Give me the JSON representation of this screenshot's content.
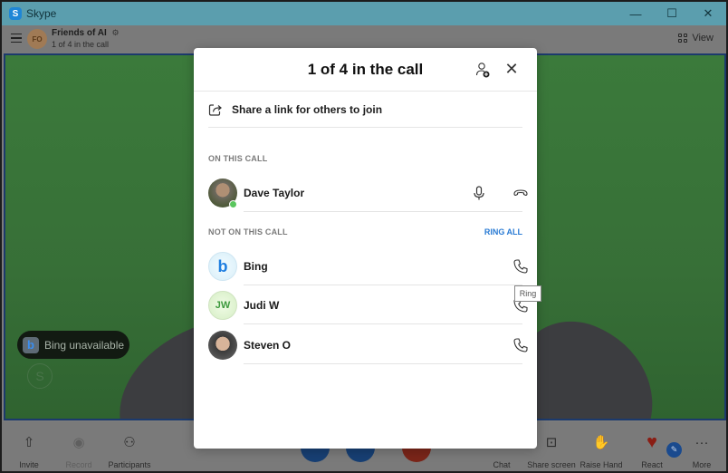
{
  "window": {
    "app_title": "Skype",
    "app_logo_letter": "S",
    "controls": {
      "minimize": "—",
      "maximize": "☐",
      "close": "✕"
    }
  },
  "header": {
    "group_initials": "FO",
    "group_name": "Friends of AI",
    "group_settings_icon": "⚙",
    "call_status": "1 of 4 in the call",
    "view_label": "View"
  },
  "video": {
    "bing_notice": "Bing unavailable",
    "bing_letter": "b",
    "watermark_letter": "S"
  },
  "modal": {
    "title": "1 of 4 in the call",
    "close_glyph": "✕",
    "share_link_label": "Share a link for others to join",
    "on_call_header": "ON THIS CALL",
    "not_on_call_header": "NOT ON THIS CALL",
    "ring_all_label": "RING ALL",
    "on_call": [
      {
        "name": "Dave Taylor",
        "status": "online"
      }
    ],
    "not_on_call": [
      {
        "name": "Bing",
        "avatar_letter": "b"
      },
      {
        "name": "Judi W",
        "initials": "JW"
      },
      {
        "name": "Steven O"
      }
    ],
    "tooltip": "Ring"
  },
  "toolbar": {
    "items": [
      {
        "label": "Invite",
        "icon": "share-up-icon"
      },
      {
        "label": "Record",
        "icon": "record-icon",
        "disabled": true
      },
      {
        "label": "Participants",
        "icon": "participants-icon"
      },
      {
        "label": "Chat",
        "icon": "chat-icon"
      },
      {
        "label": "Share screen",
        "icon": "share-screen-icon"
      },
      {
        "label": "Raise Hand",
        "icon": "hand-icon"
      },
      {
        "label": "React",
        "icon": "heart-icon"
      },
      {
        "label": "More",
        "icon": "more-icon"
      }
    ],
    "glyphs": {
      "invite": "⇧",
      "record": "◉",
      "participants": "⚇",
      "share_screen": "⊡",
      "hand": "✋",
      "heart": "♥",
      "more": "···",
      "edit": "✎"
    }
  },
  "colors": {
    "titlebar": "#5b9eae",
    "accent_blue": "#2a7bd4",
    "presence_green": "#5ac65e",
    "end_call_red": "#7a2519"
  }
}
